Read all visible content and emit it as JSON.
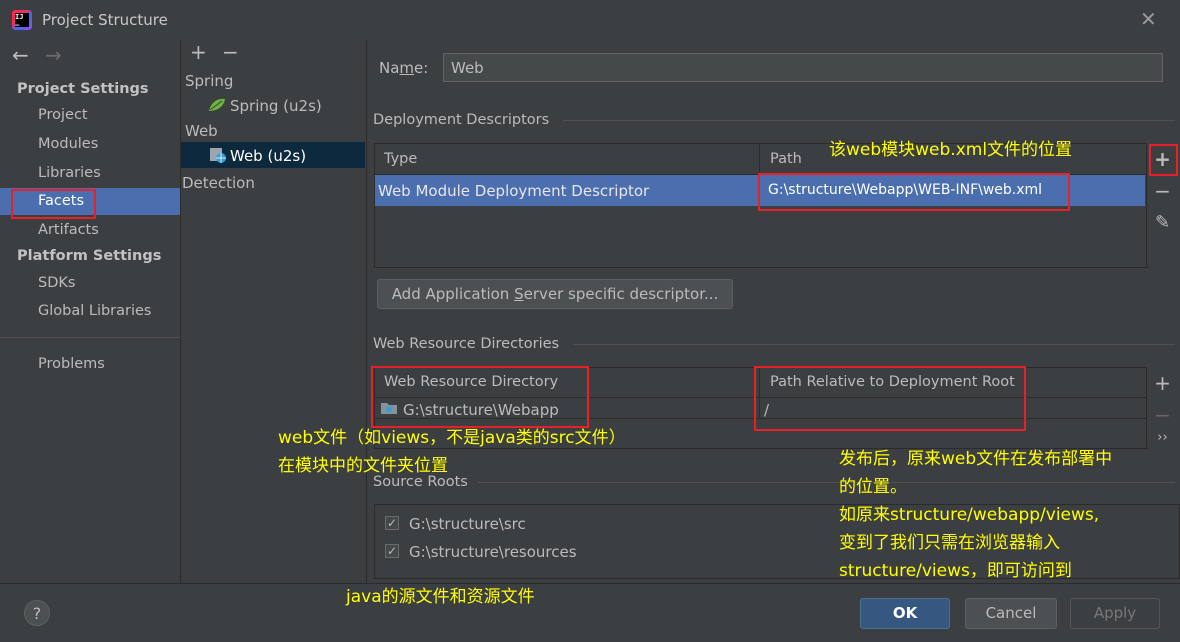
{
  "window": {
    "title": "Project Structure",
    "close_glyph": "✕"
  },
  "nav": {
    "back_glyph": "←",
    "forward_glyph": "→",
    "project_settings": "Project Settings",
    "items": [
      "Project",
      "Modules",
      "Libraries",
      "Facets",
      "Artifacts"
    ],
    "platform_settings": "Platform Settings",
    "platform_items": [
      "SDKs",
      "Global Libraries"
    ],
    "problems": "Problems",
    "selected": "Facets"
  },
  "tree": {
    "add_glyph": "+",
    "remove_glyph": "−",
    "spring": "Spring",
    "spring_child": "Spring (u2s)",
    "web": "Web",
    "web_child": "Web (u2s)",
    "detection": "Detection"
  },
  "form": {
    "name_label_pre": "Na",
    "name_label_u": "m",
    "name_label_post": "e:",
    "name_value": "Web",
    "dd_title": "Deployment Descriptors",
    "dd_col_type": "Type",
    "dd_col_path": "Path",
    "dd_row_type": "Web Module Deployment Descriptor",
    "dd_row_path": "G:\\structure\\Webapp\\WEB-INF\\web.xml",
    "add_btn_pre": "Add Application ",
    "add_btn_u": "S",
    "add_btn_post": "erver specific descriptor...",
    "wr_title": "Web Resource Directories",
    "wr_col_dir": "Web Resource Directory",
    "wr_col_rel": "Path Relative to Deployment Root",
    "wr_row_dir": "G:\\structure\\Webapp",
    "wr_row_rel": "/",
    "sr_title": "Source Roots",
    "sr_items": [
      "G:\\structure\\src",
      "G:\\structure\\resources"
    ],
    "tool_add": "+",
    "tool_remove": "−",
    "tool_edit": "✎",
    "tool_more": "››"
  },
  "annotations": {
    "a1": "该web模块web.xml文件的位置",
    "a2_line1": "web文件（如views，不是java类的src文件）",
    "a2_line2": "在模块中的文件夹位置",
    "a3_line1": "发布后，原来web文件在发布部署中",
    "a3_line2": "的位置。",
    "a3_line3": "如原来structure/webapp/views,",
    "a3_line4": "变到了我们只需在浏览器输入",
    "a3_line5": "structure/views，即可访问到",
    "a4": "java的源文件和资源文件"
  },
  "buttons": {
    "help": "?",
    "ok": "OK",
    "cancel": "Cancel",
    "apply": "Apply"
  },
  "colors": {
    "selection": "#4b6eaf",
    "annotation": "#ffff00",
    "highlight_box": "#e8202a"
  }
}
